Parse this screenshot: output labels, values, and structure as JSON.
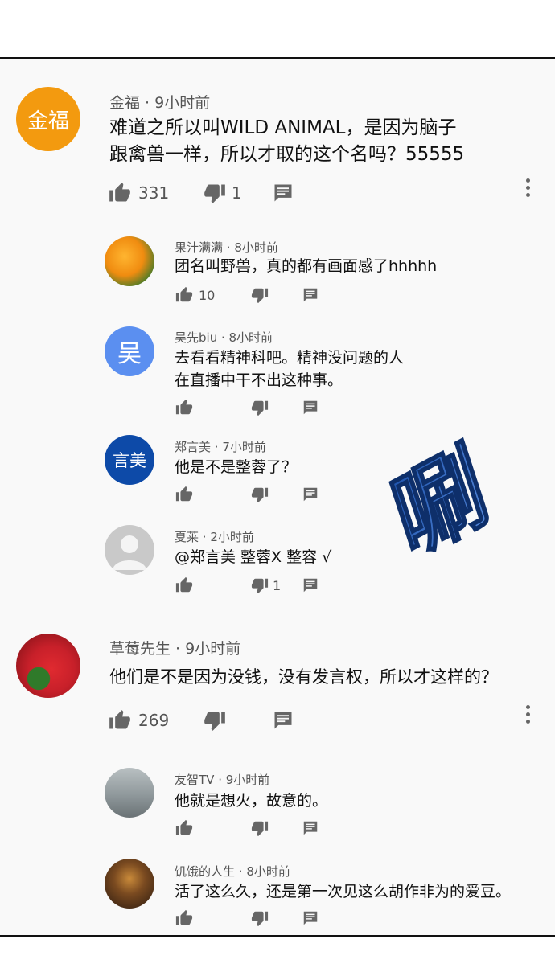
{
  "sticker": "唰",
  "comments": [
    {
      "avatar_text": "金福",
      "avatar_color": "#f39a0f",
      "author": "金福",
      "time": "9小时前",
      "lines": [
        "难道之所以叫WILD ANIMAL，是因为脑子",
        "跟禽兽一样，所以才取的这个名吗？55555"
      ],
      "likes": "331",
      "dislikes": "1",
      "replies": [
        {
          "avatar_text": "",
          "avatar_color": "#e08a10",
          "author": "果汁满满",
          "time": "8小时前",
          "lines": [
            "团名叫野兽，真的都有画面感了hhhhh"
          ],
          "likes": "10",
          "dislikes": ""
        },
        {
          "avatar_text": "吴",
          "avatar_color": "#5b8ff0",
          "author": "吴先biu",
          "time": "8小时前",
          "lines": [
            "去看看精神科吧。精神没问题的人",
            "在直播中干不出这种事。"
          ],
          "likes": "",
          "dislikes": ""
        },
        {
          "avatar_text": "言美",
          "avatar_color": "#0d4aa8",
          "author": "郑言美",
          "time": "7小时前",
          "lines": [
            "他是不是整蓉了？"
          ],
          "likes": "",
          "dislikes": ""
        },
        {
          "avatar_text": "",
          "avatar_color": "#c9c9c9",
          "author": "夏莱",
          "time": "2小时前",
          "lines": [
            "@郑言美 整蓉X 整容 √"
          ],
          "likes": "",
          "dislikes": "1"
        }
      ]
    },
    {
      "avatar_text": "",
      "avatar_color": "#c8202a",
      "author": "草莓先生",
      "time": "9小时前",
      "lines": [
        "他们是不是因为没钱，没有发言权，所以才这样的？"
      ],
      "likes": "269",
      "dislikes": "",
      "replies": [
        {
          "avatar_text": "",
          "avatar_color": "#9aa2a4",
          "author": "友智TV",
          "time": "9小时前",
          "lines": [
            "他就是想火，故意的。"
          ],
          "likes": "",
          "dislikes": ""
        },
        {
          "avatar_text": "",
          "avatar_color": "#5a3a20",
          "author": "饥饿的人生",
          "time": "8小时前",
          "lines": [
            "活了这么久，还是第一次见这么胡作非为的爱豆。"
          ],
          "likes": "",
          "dislikes": ""
        }
      ]
    }
  ]
}
